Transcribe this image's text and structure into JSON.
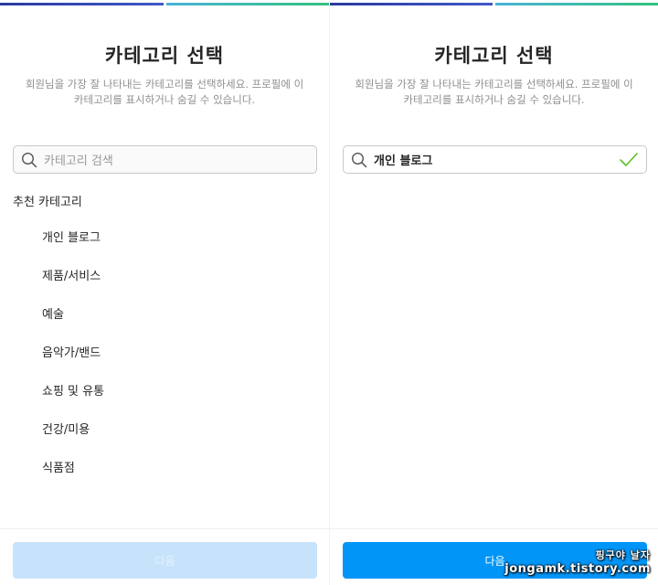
{
  "colors": {
    "accent": "#0095f6",
    "button_disabled": "#c6e3fb",
    "check": "#58c322",
    "subtitle": "#8e8e8e"
  },
  "left_panel": {
    "title": "카테고리 선택",
    "subtitle_line1": "회원님을 가장 잘 나타내는 카테고리를 선택하세요. 프로필에 이",
    "subtitle_line2": "카테고리를 표시하거나 숨길 수 있습니다.",
    "search": {
      "icon": "search-icon",
      "placeholder": "카테고리 검색",
      "value": ""
    },
    "section_title": "추천 카테고리",
    "categories": [
      "개인 블로그",
      "제품/서비스",
      "예술",
      "음악가/밴드",
      "쇼핑 및 유통",
      "건강/미용",
      "식품점"
    ],
    "next_button": {
      "label": "다음",
      "state": "disabled"
    }
  },
  "right_panel": {
    "title": "카테고리 선택",
    "subtitle_line1": "회원님을 가장 잘 나타내는 카테고리를 선택하세요. 프로필에 이",
    "subtitle_line2": "카테고리를 표시하거나 숨길 수 있습니다.",
    "search": {
      "icon": "search-icon",
      "value": "개인 블로그",
      "status_icon": "check-icon"
    },
    "next_button": {
      "label": "다음",
      "state": "enabled"
    }
  },
  "watermark": {
    "line1": "핑구야 날자",
    "line2": "jongamk.tistory.com"
  }
}
